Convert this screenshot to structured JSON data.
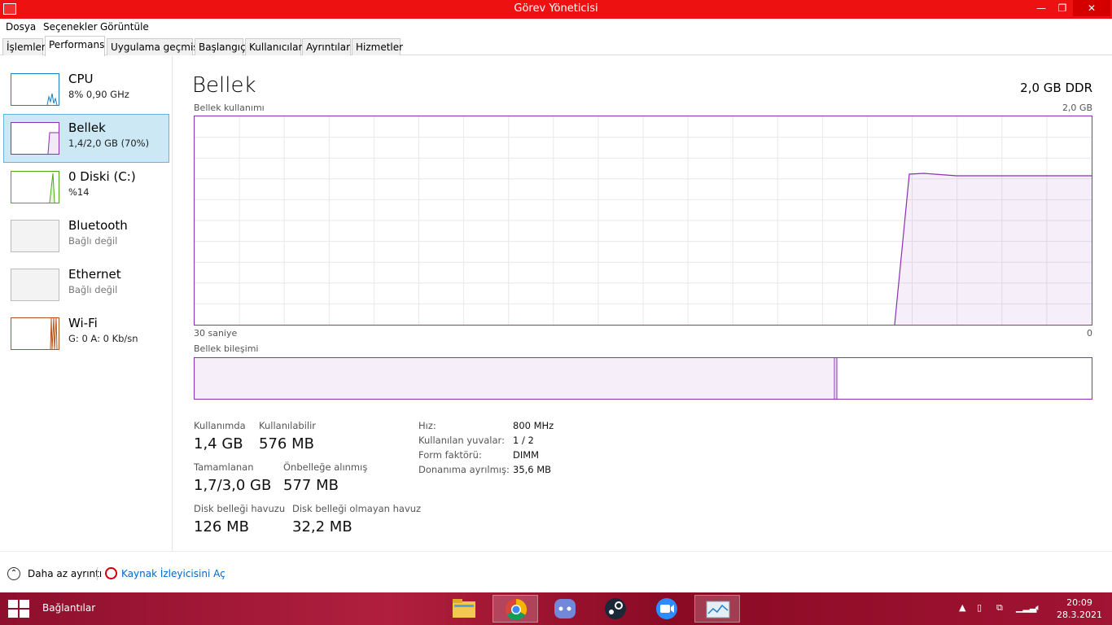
{
  "window": {
    "title": "Görev Yöneticisi",
    "minimize": "—",
    "maximize": "❐",
    "close": "✕"
  },
  "menu": [
    "Dosya",
    "Seçenekler",
    "Görüntüle"
  ],
  "tabs": [
    "İşlemler",
    "Performans",
    "Uygulama geçmişi",
    "Başlangıç",
    "Kullanıcılar",
    "Ayrıntılar",
    "Hizmetler"
  ],
  "active_tab": "Performans",
  "sidebar": [
    {
      "name": "CPU",
      "sub": "8% 0,90 GHz",
      "color": "#1a7fc4"
    },
    {
      "name": "Bellek",
      "sub": "1,4/2,0 GB (70%)",
      "color": "#8b2fb5"
    },
    {
      "name": "0 Diski (C:)",
      "sub": "%14",
      "color": "#4da818"
    },
    {
      "name": "Bluetooth",
      "sub": "Bağlı değil",
      "color": "#999999"
    },
    {
      "name": "Ethernet",
      "sub": "Bağlı değil",
      "color": "#999999"
    },
    {
      "name": "Wi-Fi",
      "sub": "G: 0 A: 0 Kb/sn",
      "color": "#b5531a"
    }
  ],
  "main": {
    "title": "Bellek",
    "type": "2,0 GB DDR",
    "usage_label": "Bellek kullanımı",
    "usage_max": "2,0 GB",
    "time_left": "30 saniye",
    "time_right": "0",
    "composition_label": "Bellek bileşimi",
    "accent": "#8b2fb5",
    "stats": {
      "in_use_label": "Kullanımda",
      "in_use": "1,4 GB",
      "available_label": "Kullanılabilir",
      "available": "576 MB",
      "committed_label": "Tamamlanan",
      "committed": "1,7/3,0 GB",
      "cached_label": "Önbelleğe alınmış",
      "cached": "577 MB",
      "paged_label": "Disk belleği havuzu",
      "paged": "126 MB",
      "nonpaged_label": "Disk belleği olmayan havuz",
      "nonpaged": "32,2 MB"
    },
    "details": [
      {
        "label": "Hız:",
        "value": "800 MHz"
      },
      {
        "label": "Kullanılan yuvalar:",
        "value": "1 / 2"
      },
      {
        "label": "Form faktörü:",
        "value": "DIMM"
      },
      {
        "label": "Donanıma ayrılmış:",
        "value": "35,6 MB"
      }
    ]
  },
  "footer": {
    "fewer_details": "Daha az ayrıntı",
    "resource_monitor": "Kaynak İzleyicisini Aç"
  },
  "taskbar": {
    "label": "Bağlantılar",
    "apps": [
      "file-explorer-icon",
      "chrome-icon",
      "discord-icon",
      "steam-icon",
      "zoom-icon",
      "task-manager-icon"
    ],
    "time": "20:09",
    "date": "28.3.2021"
  }
}
